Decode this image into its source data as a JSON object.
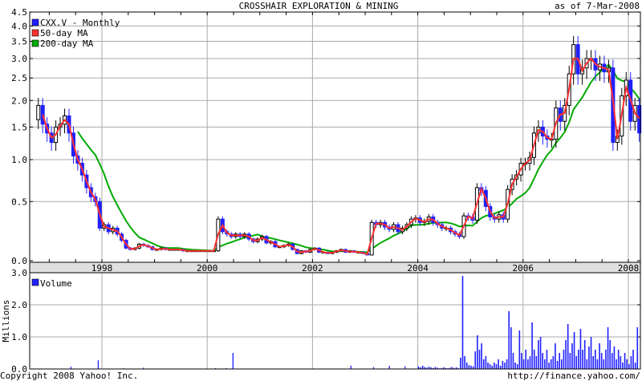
{
  "header": {
    "title": "CROSSHAIR EXPLORATION & MINING",
    "as_of": "as of  7-Mar-2008"
  },
  "footer": {
    "copyright": "Copyright 2008 Yahoo! Inc.",
    "url": "http://finance.yahoo.com/"
  },
  "colors": {
    "down": "#2020ff",
    "up": "#ffffff",
    "ma50": "#ff3030",
    "ma200": "#00aa00",
    "volume": "#2020ff",
    "grid": "#aaaaaa",
    "band": "#e0e0e0"
  },
  "chart_data": [
    {
      "type": "candlestick",
      "title": "CROSSHAIR EXPLORATION & MINING",
      "ylabel": "",
      "ylim": [
        0,
        4.5
      ],
      "yticks": [
        "0.0",
        "0.5",
        "1.0",
        "1.5",
        "2.0",
        "2.5",
        "3.0",
        "3.5",
        "4.0",
        "4.5"
      ],
      "ytick_values": [
        0,
        0.5,
        1.0,
        1.5,
        2.0,
        2.5,
        3.0,
        3.5,
        4.0,
        4.5
      ],
      "xticks": [
        "1998",
        "2000",
        "2002",
        "2004",
        "2006",
        "2008"
      ],
      "xtick_values": [
        1998,
        2000,
        2002,
        2004,
        2006,
        2008
      ],
      "x_range": [
        1996.7,
        2008.2
      ],
      "grid": true,
      "legend": {
        "placement": "top-left",
        "entries": [
          {
            "label": "CXX.V - Monthly",
            "color": "#2020ff"
          },
          {
            "label": "50-day MA",
            "color": "#ff3030"
          },
          {
            "label": "200-day MA",
            "color": "#00aa00"
          }
        ]
      },
      "start_month": "1996-10",
      "first_open": 1.63,
      "closes": [
        1.9,
        1.55,
        1.4,
        1.25,
        1.5,
        1.55,
        1.7,
        1.4,
        1.05,
        0.95,
        0.8,
        0.65,
        0.55,
        0.5,
        0.25,
        0.28,
        0.22,
        0.25,
        0.2,
        0.15,
        0.09,
        0.08,
        0.09,
        0.12,
        0.11,
        0.1,
        0.08,
        0.08,
        0.09,
        0.08,
        0.08,
        0.08,
        0.08,
        0.07,
        0.07,
        0.07,
        0.07,
        0.07,
        0.07,
        0.07,
        0.07,
        0.33,
        0.22,
        0.2,
        0.18,
        0.2,
        0.18,
        0.2,
        0.16,
        0.14,
        0.16,
        0.18,
        0.13,
        0.14,
        0.1,
        0.1,
        0.11,
        0.12,
        0.08,
        0.05,
        0.07,
        0.06,
        0.08,
        0.09,
        0.06,
        0.06,
        0.05,
        0.06,
        0.07,
        0.08,
        0.06,
        0.07,
        0.06,
        0.06,
        0.05,
        0.04,
        0.3,
        0.28,
        0.3,
        0.26,
        0.24,
        0.28,
        0.22,
        0.25,
        0.28,
        0.33,
        0.34,
        0.3,
        0.31,
        0.35,
        0.3,
        0.28,
        0.25,
        0.25,
        0.22,
        0.2,
        0.18,
        0.36,
        0.35,
        0.32,
        0.65,
        0.62,
        0.45,
        0.35,
        0.33,
        0.37,
        0.33,
        0.63,
        0.75,
        0.8,
        0.95,
        0.95,
        1.03,
        1.4,
        1.5,
        1.35,
        1.3,
        1.3,
        1.85,
        1.6,
        1.9,
        2.6,
        3.4,
        2.6,
        2.75,
        3.0,
        3.0,
        2.7,
        2.85,
        2.65,
        2.75,
        1.25,
        1.35,
        2.1,
        2.45,
        1.6,
        1.9,
        1.4
      ],
      "ma_windows_months": {
        "ma50": 2,
        "ma200": 10
      }
    },
    {
      "type": "bar",
      "title": "Volume",
      "ylabel": "Millions",
      "ylim": [
        0,
        3.0
      ],
      "yticks": [
        "0.0",
        "1.0",
        "2.0",
        "3.0"
      ],
      "ytick_values": [
        0,
        1,
        2,
        3
      ],
      "legend": {
        "placement": "top-left",
        "entries": [
          {
            "label": "Volume",
            "color": "#2020ff"
          }
        ]
      },
      "early_bars": [
        [
          1997.4,
          0.07
        ],
        [
          1997.92,
          0.27
        ],
        [
          1998.78,
          0.04
        ],
        [
          1998.4,
          0.02
        ],
        [
          2000.15,
          0.03
        ],
        [
          2000.35,
          0.03
        ],
        [
          2000.48,
          0.5
        ],
        [
          2002.72,
          0.1
        ],
        [
          2003.15,
          0.06
        ],
        [
          2003.45,
          0.1
        ],
        [
          2003.75,
          0.08
        ]
      ],
      "series_start": 2004.0,
      "series_step_years": 0.04,
      "values": [
        0.08,
        0.05,
        0.1,
        0.06,
        0.04,
        0.07,
        0.05,
        0.03,
        0.06,
        0.04,
        0.02,
        0.03,
        0.05,
        0.03,
        0.02,
        0.04,
        0.06,
        0.03,
        0.05,
        0.02,
        0.35,
        2.9,
        0.4,
        0.2,
        0.12,
        0.1,
        0.08,
        0.55,
        1.05,
        0.6,
        0.8,
        0.3,
        0.4,
        0.2,
        0.15,
        0.1,
        0.2,
        0.15,
        0.3,
        0.1,
        0.25,
        0.2,
        0.3,
        1.8,
        1.3,
        0.5,
        0.2,
        0.15,
        1.2,
        0.5,
        0.3,
        0.6,
        0.3,
        0.4,
        1.45,
        0.6,
        0.4,
        0.9,
        1.0,
        0.5,
        0.3,
        0.6,
        0.2,
        0.3,
        0.4,
        0.8,
        0.25,
        0.5,
        0.3,
        0.6,
        0.9,
        1.4,
        0.5,
        0.8,
        1.15,
        0.4,
        0.6,
        1.25,
        0.6,
        0.9,
        0.3,
        0.7,
        1.0,
        0.4,
        0.6,
        0.3,
        0.8,
        0.5,
        0.3,
        0.6,
        1.3,
        0.9,
        0.5,
        0.7,
        0.3,
        0.6,
        0.4,
        0.2,
        0.5,
        0.3,
        0.15,
        0.4,
        0.6,
        0.2,
        1.3
      ]
    }
  ]
}
